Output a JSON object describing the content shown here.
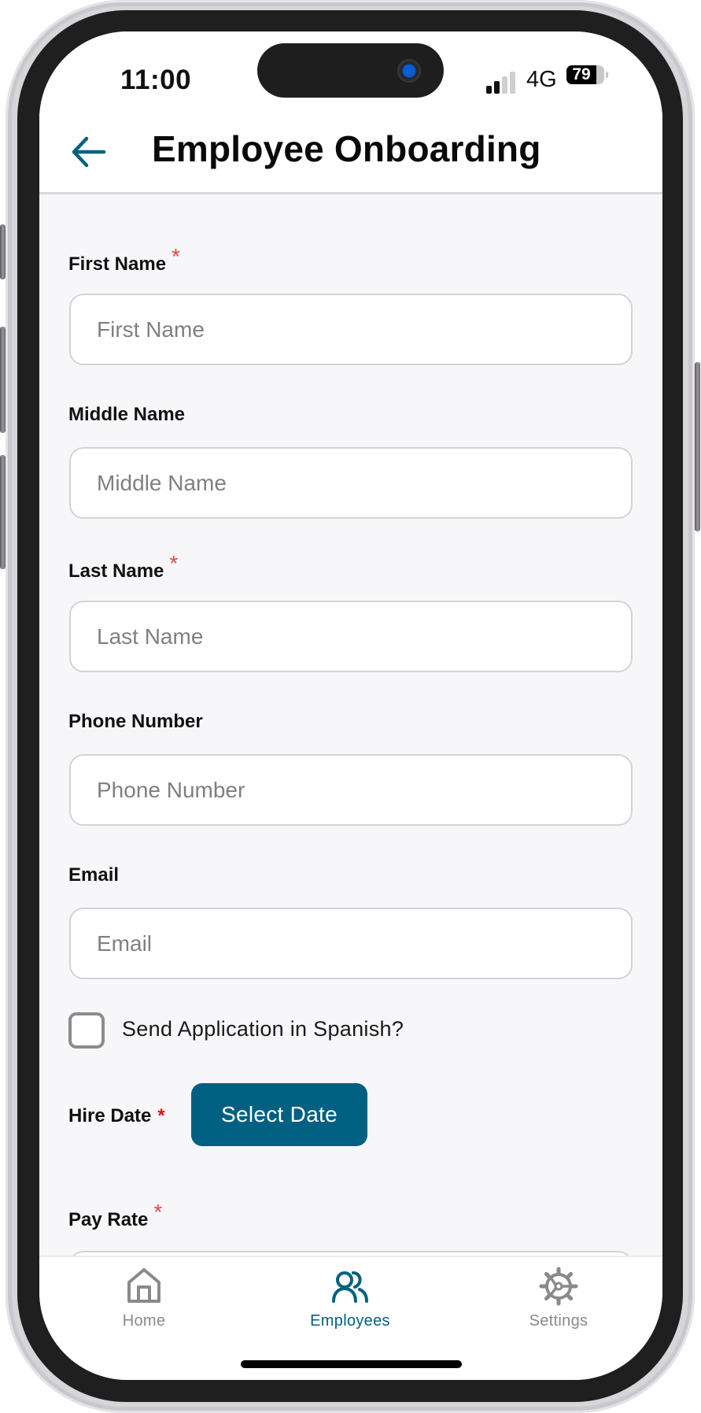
{
  "status_bar": {
    "time": "11:00",
    "network": "4G",
    "battery_percent": 79,
    "battery_label": "79",
    "signal_bars_active": 2,
    "signal_bars_total": 4
  },
  "header": {
    "title": "Employee Onboarding",
    "back_icon": "arrow-left-icon"
  },
  "form": {
    "fields": [
      {
        "label": "First Name",
        "required": true,
        "required_mark": "*",
        "placeholder": "First Name",
        "value": ""
      },
      {
        "label": "Middle Name",
        "required": false,
        "placeholder": "Middle Name",
        "value": ""
      },
      {
        "label": "Last Name",
        "required": true,
        "required_mark": "*",
        "placeholder": "Last Name",
        "value": ""
      },
      {
        "label": "Phone Number",
        "required": false,
        "placeholder": "Phone Number",
        "value": ""
      },
      {
        "label": "Email",
        "required": false,
        "placeholder": "Email",
        "value": ""
      }
    ],
    "spanish_checkbox": {
      "label": "Send Application in Spanish?",
      "checked": false
    },
    "hire_date": {
      "label": "Hire Date",
      "required_mark": "*",
      "button_label": "Select Date"
    },
    "pay_rate": {
      "label": "Pay Rate",
      "required_mark": "*",
      "value": ""
    }
  },
  "tab_bar": {
    "tabs": [
      {
        "label": "Home",
        "icon": "home-icon",
        "active": false
      },
      {
        "label": "Employees",
        "icon": "users-icon",
        "active": true
      },
      {
        "label": "Settings",
        "icon": "gear-icon",
        "active": false
      }
    ]
  },
  "colors": {
    "accent": "#00617f",
    "required": "#e0474c",
    "button_bg": "#006081",
    "inactive_tab": "#8a8a8a",
    "background": "#f7f7f9"
  }
}
